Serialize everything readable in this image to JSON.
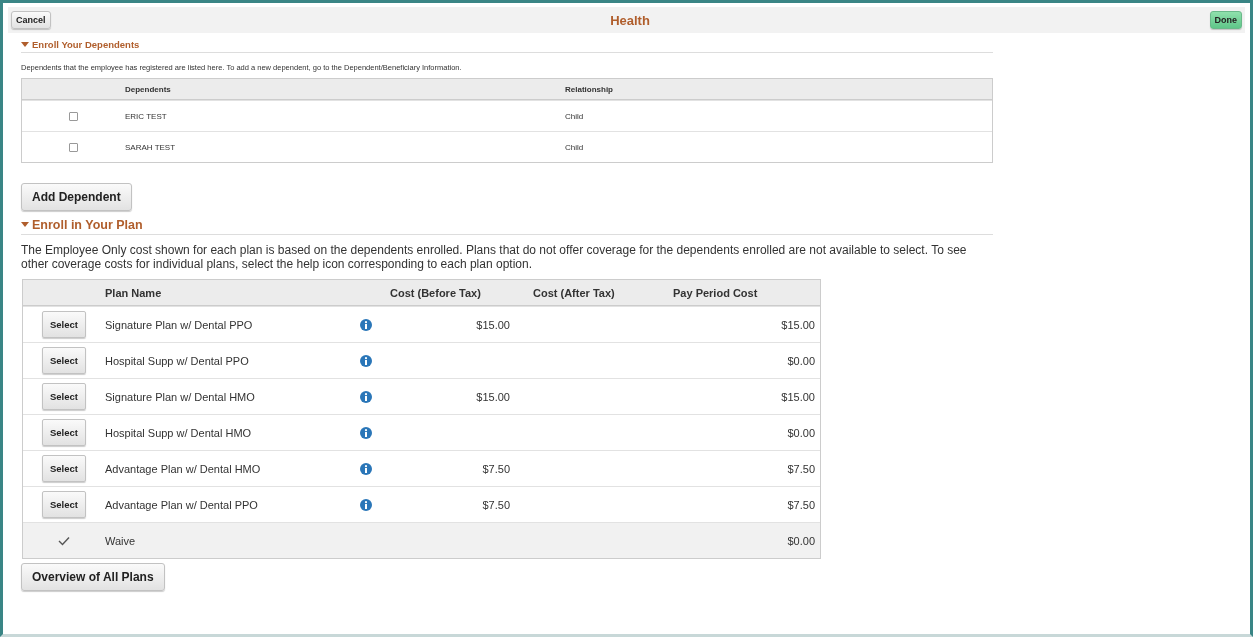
{
  "header": {
    "cancel": "Cancel",
    "title": "Health",
    "done": "Done"
  },
  "dependents_section": {
    "title": "Enroll Your Dependents",
    "expanded": true,
    "description": "Dependents that the employee has registered are listed here. To add a new dependent, go to the Dependent/Beneficiary Information.",
    "columns": [
      "Dependents",
      "Relationship"
    ],
    "rows": [
      {
        "checked": false,
        "name": "ERIC TEST",
        "relationship": "Child"
      },
      {
        "checked": false,
        "name": "SARAH TEST",
        "relationship": "Child"
      }
    ],
    "add_button": "Add Dependent"
  },
  "plan_section": {
    "title": "Enroll in Your Plan",
    "expanded": true,
    "description": "The Employee Only cost shown for each plan is based on the dependents enrolled. Plans that do not offer coverage for the dependents enrolled are not available to select. To see other coverage costs for individual plans, select the help icon corresponding to each plan option.",
    "columns": [
      "Plan Name",
      "Cost (Before Tax)",
      "Cost (After Tax)",
      "Pay Period Cost"
    ],
    "rows": [
      {
        "selected": false,
        "button": "Select",
        "name": "Signature Plan w/ Dental PPO",
        "info": true,
        "before_tax": "$15.00",
        "pay_period": "$15.00"
      },
      {
        "selected": false,
        "button": "Select",
        "name": "Hospital Supp w/ Dental PPO",
        "info": true,
        "pay_period": "$0.00"
      },
      {
        "selected": false,
        "button": "Select",
        "name": "Signature Plan w/ Dental HMO",
        "info": true,
        "before_tax": "$15.00",
        "pay_period": "$15.00"
      },
      {
        "selected": false,
        "button": "Select",
        "name": "Hospital Supp w/ Dental HMO",
        "info": true,
        "pay_period": "$0.00"
      },
      {
        "selected": false,
        "button": "Select",
        "name": "Advantage Plan w/ Dental HMO",
        "info": true,
        "before_tax": "$7.50",
        "pay_period": "$7.50"
      },
      {
        "selected": false,
        "button": "Select",
        "name": "Advantage Plan w/ Dental PPO",
        "info": true,
        "before_tax": "$7.50",
        "pay_period": "$7.50"
      },
      {
        "selected": true,
        "name": "Waive",
        "info": false,
        "pay_period": "$0.00"
      }
    ],
    "overview_button": "Overview of All Plans"
  }
}
